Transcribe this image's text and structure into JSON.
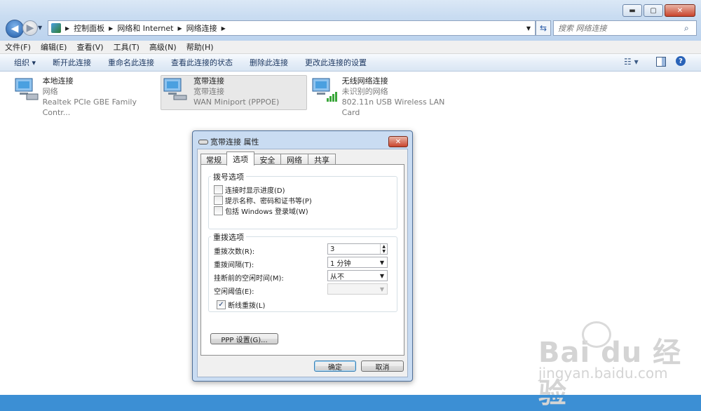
{
  "window": {
    "caption_buttons": {
      "min": "▬",
      "max": "▢",
      "close": "✕"
    },
    "address_parts": [
      "控制面板",
      "网络和 Internet",
      "网络连接"
    ],
    "search_placeholder": "搜索 网络连接"
  },
  "menu": [
    "文件(F)",
    "编辑(E)",
    "查看(V)",
    "工具(T)",
    "高级(N)",
    "帮助(H)"
  ],
  "toolbar": {
    "organize": "组织 ▾",
    "items": [
      "断开此连接",
      "重命名此连接",
      "查看此连接的状态",
      "删除此连接",
      "更改此连接的设置"
    ]
  },
  "connections": [
    {
      "name": "本地连接",
      "status": "网络",
      "device": "Realtek PCIe GBE Family Contr..."
    },
    {
      "name": "宽带连接",
      "status": "宽带连接",
      "device": "WAN Miniport (PPPOE)"
    },
    {
      "name": "无线网络连接",
      "status": "未识别的网络",
      "device": "802.11n USB Wireless LAN Card"
    }
  ],
  "dialog": {
    "title": "宽带连接 属性",
    "tabs": [
      "常规",
      "选项",
      "安全",
      "网络",
      "共享"
    ],
    "active_tab": "选项",
    "dial_group": "拨号选项",
    "dial_options": [
      {
        "label": "连接时显示进度(D)",
        "checked": false
      },
      {
        "label": "提示名称、密码和证书等(P)",
        "checked": false
      },
      {
        "label": "包括 Windows 登录域(W)",
        "checked": false
      }
    ],
    "redial_group": "重拨选项",
    "redial_attempts_label": "重拨次数(R):",
    "redial_attempts_value": "3",
    "redial_interval_label": "重拨间隔(T):",
    "redial_interval_value": "1 分钟",
    "idle_hangup_label": "挂断前的空闲时间(M):",
    "idle_hangup_value": "从不",
    "idle_threshold_label": "空闲阈值(E):",
    "idle_threshold_value": "",
    "redial_on_drop_label": "断线重拨(L)",
    "redial_on_drop_checked": true,
    "ppp_button": "PPP 设置(G)...",
    "ok_button": "确定",
    "cancel_button": "取消"
  },
  "watermark": {
    "brand": "Bai du 经验",
    "url": "jingyan.baidu.com"
  }
}
